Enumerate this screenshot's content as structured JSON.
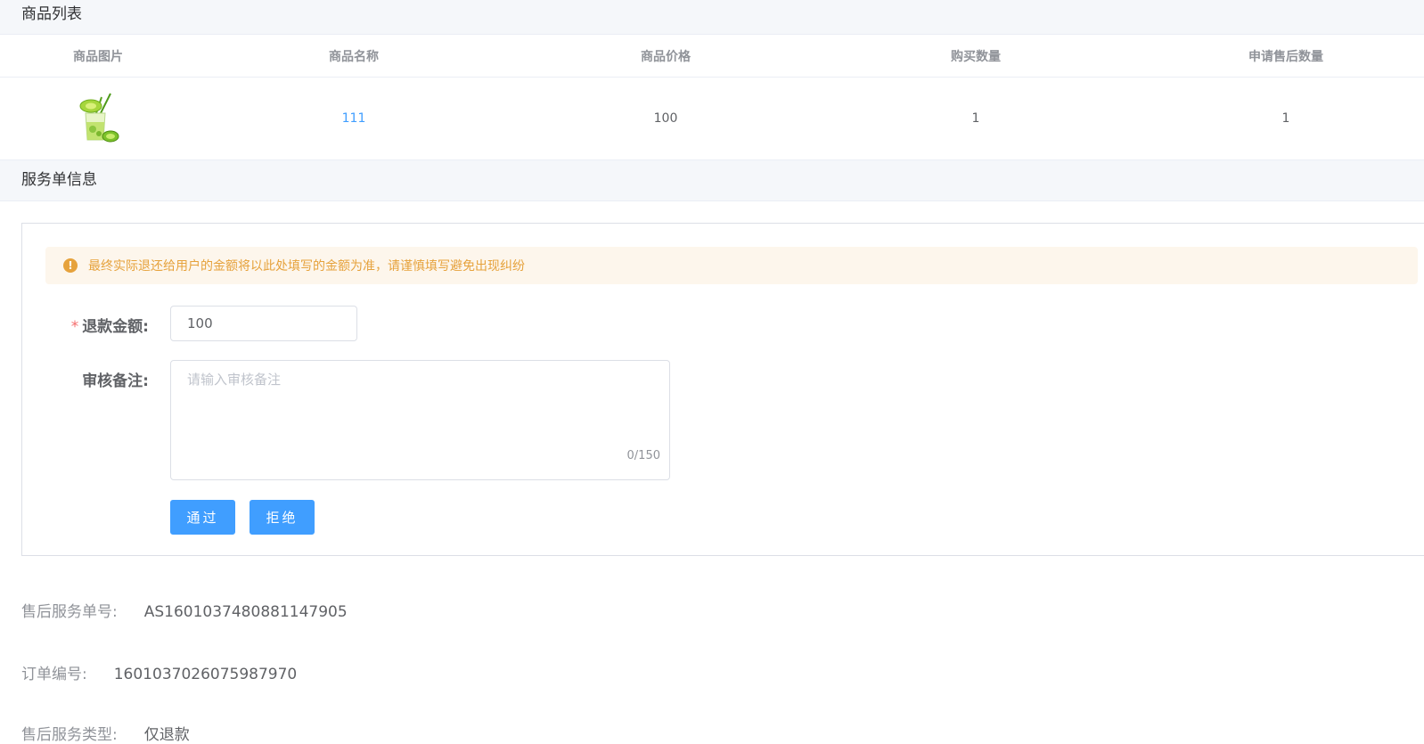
{
  "goods_section": {
    "title": "商品列表",
    "columns": [
      "商品图片",
      "商品名称",
      "商品价格",
      "购买数量",
      "申请售后数量"
    ],
    "rows": [
      {
        "image_icon": "lime-drink-image",
        "name": "111",
        "price": "100",
        "quantity": "1",
        "after_sale_quantity": "1"
      }
    ]
  },
  "service_section": {
    "title": "服务单信息",
    "alert": {
      "icon": "warning-icon",
      "text": "最终实际退还给用户的金额将以此处填写的金额为准，请谨慎填写避免出现纠纷"
    },
    "refund": {
      "required_mark": "*",
      "label": "退款金额:",
      "value": "100"
    },
    "remark": {
      "label": "审核备注:",
      "placeholder": "请输入审核备注",
      "value": "",
      "counter": "0/150"
    },
    "buttons": {
      "approve": "通过",
      "reject": "拒绝"
    }
  },
  "info": {
    "service_no_label": "售后服务单号:",
    "service_no": "AS1601037480881147905",
    "order_no_label": "订单编号:",
    "order_no": "1601037026075987970",
    "type_label": "售后服务类型:",
    "type": "仅退款"
  },
  "colors": {
    "primary": "#409eff",
    "warning": "#e6a23c",
    "warning_bg": "#fdf6ec",
    "danger": "#f56c6c",
    "header_bg": "#f5f7fa"
  }
}
